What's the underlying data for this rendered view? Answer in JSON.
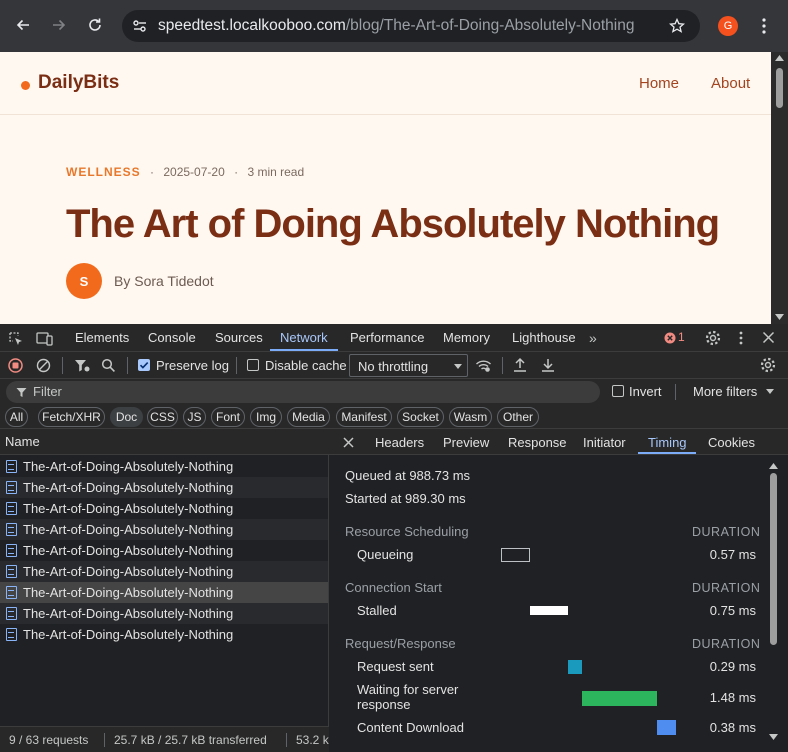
{
  "browser": {
    "url_host": "speedtest.localkooboo.com",
    "url_path": "/blog/The-Art-of-Doing-Absolutely-Nothing",
    "profile_initial": "G"
  },
  "site": {
    "logo": "DailyBits",
    "nav": [
      "Home",
      "About"
    ],
    "category": "WELLNESS",
    "date": "2025-07-20",
    "read_time": "3 min read",
    "sep": "·",
    "title": "The Art of Doing Absolutely Nothing",
    "author_initial": "S",
    "author_line": "By Sora Tidedot",
    "colors": {
      "accent": "#f26b1d",
      "title": "#7a2e14",
      "background": "#fff8f1"
    }
  },
  "devtools": {
    "tabs": [
      "Elements",
      "Console",
      "Sources",
      "Network",
      "Performance",
      "Memory",
      "Lighthouse"
    ],
    "active_tab": "Network",
    "error_count": "1",
    "toolbar": {
      "preserve_log": "Preserve log",
      "preserve_log_checked": true,
      "disable_cache": "Disable cache",
      "disable_cache_checked": false,
      "throttling": "No throttling"
    },
    "filter": {
      "placeholder": "Filter",
      "invert": "Invert",
      "more_filters": "More filters"
    },
    "types": [
      "All",
      "Fetch/XHR",
      "Doc",
      "CSS",
      "JS",
      "Font",
      "Img",
      "Media",
      "Manifest",
      "Socket",
      "Wasm",
      "Other"
    ],
    "active_type": "Doc",
    "name_header": "Name",
    "requests": [
      "The-Art-of-Doing-Absolutely-Nothing",
      "The-Art-of-Doing-Absolutely-Nothing",
      "The-Art-of-Doing-Absolutely-Nothing",
      "The-Art-of-Doing-Absolutely-Nothing",
      "The-Art-of-Doing-Absolutely-Nothing",
      "The-Art-of-Doing-Absolutely-Nothing",
      "The-Art-of-Doing-Absolutely-Nothing",
      "The-Art-of-Doing-Absolutely-Nothing",
      "The-Art-of-Doing-Absolutely-Nothing"
    ],
    "selected_request_index": 6,
    "status": {
      "requests": "9 / 63 requests",
      "transferred": "25.7 kB / 25.7 kB transferred",
      "resources": "53.2 k"
    },
    "detail_tabs": [
      "Headers",
      "Preview",
      "Response",
      "Initiator",
      "Timing",
      "Cookies"
    ],
    "active_detail_tab": "Timing",
    "timing": {
      "queued_at": "Queued at 988.73 ms",
      "started_at": "Started at 989.30 ms",
      "duration_label": "DURATION",
      "sections": [
        {
          "title": "Resource Scheduling",
          "rows": [
            {
              "label": "Queueing",
              "value": "0.57 ms",
              "color": "outline"
            }
          ]
        },
        {
          "title": "Connection Start",
          "rows": [
            {
              "label": "Stalled",
              "value": "0.75 ms",
              "color": "#ffffff"
            }
          ]
        },
        {
          "title": "Request/Response",
          "rows": [
            {
              "label": "Request sent",
              "value": "0.29 ms",
              "color": "#1a9bbd"
            },
            {
              "label": "Waiting for server response",
              "value": "1.48 ms",
              "color": "#2db55d"
            },
            {
              "label": "Content Download",
              "value": "0.38 ms",
              "color": "#4f8ef0"
            }
          ]
        }
      ]
    }
  }
}
